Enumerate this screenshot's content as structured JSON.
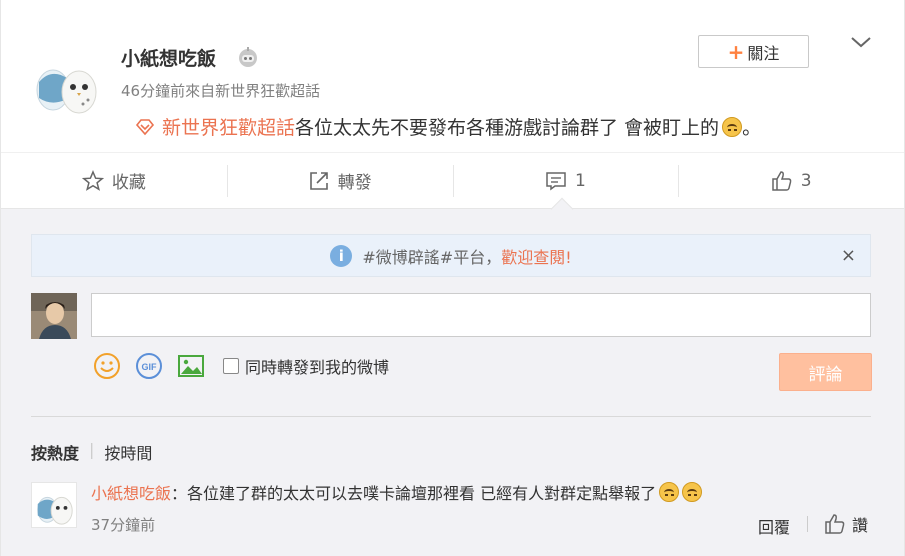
{
  "post": {
    "username": "小紙想吃飯",
    "meta": "46分鐘前來自新世界狂歡超話",
    "follow_label": "關注",
    "follow_plus": "+",
    "topic": "新世界狂歡超話",
    "text": "各位太太先不要發布各種游戲討論群了 會被盯上的",
    "text_end": "。"
  },
  "actions": {
    "favorite_label": "收藏",
    "repost_label": "轉發",
    "comment_count": "1",
    "like_count": "3"
  },
  "comment_box": {
    "notice_prefix": "#微博辟謠#平台，",
    "notice_link": "歡迎查閱!",
    "close_symbol": "×",
    "repost_option": "同時轉發到我的微博",
    "submit_label": "評論",
    "input_value": ""
  },
  "sort": {
    "hot_label": "按熱度",
    "separator": "|",
    "time_label": "按時間"
  },
  "comments": [
    {
      "user": "小紙想吃飯",
      "colon": "：",
      "text": "各位建了群的太太可以去噗卡論壇那裡看 已經有人對群定點舉報了",
      "time": "37分鐘前",
      "reply_label": "回覆",
      "like_label": "讚"
    }
  ],
  "colors": {
    "accent": "#eb7350",
    "follow_plus": "#ff8140",
    "submit_disabled": "#ffc09f",
    "notice_bg": "#eaf1fa",
    "comment_area_bg": "#f2f2f5"
  },
  "icons": [
    "robot-icon",
    "chevron-down-icon",
    "topic-diamond-icon",
    "star-icon",
    "repost-icon",
    "comment-icon",
    "thumbs-up-icon",
    "info-icon",
    "close-icon",
    "smiley-icon",
    "gif-icon",
    "image-icon",
    "upside-down-smile-emoji"
  ]
}
